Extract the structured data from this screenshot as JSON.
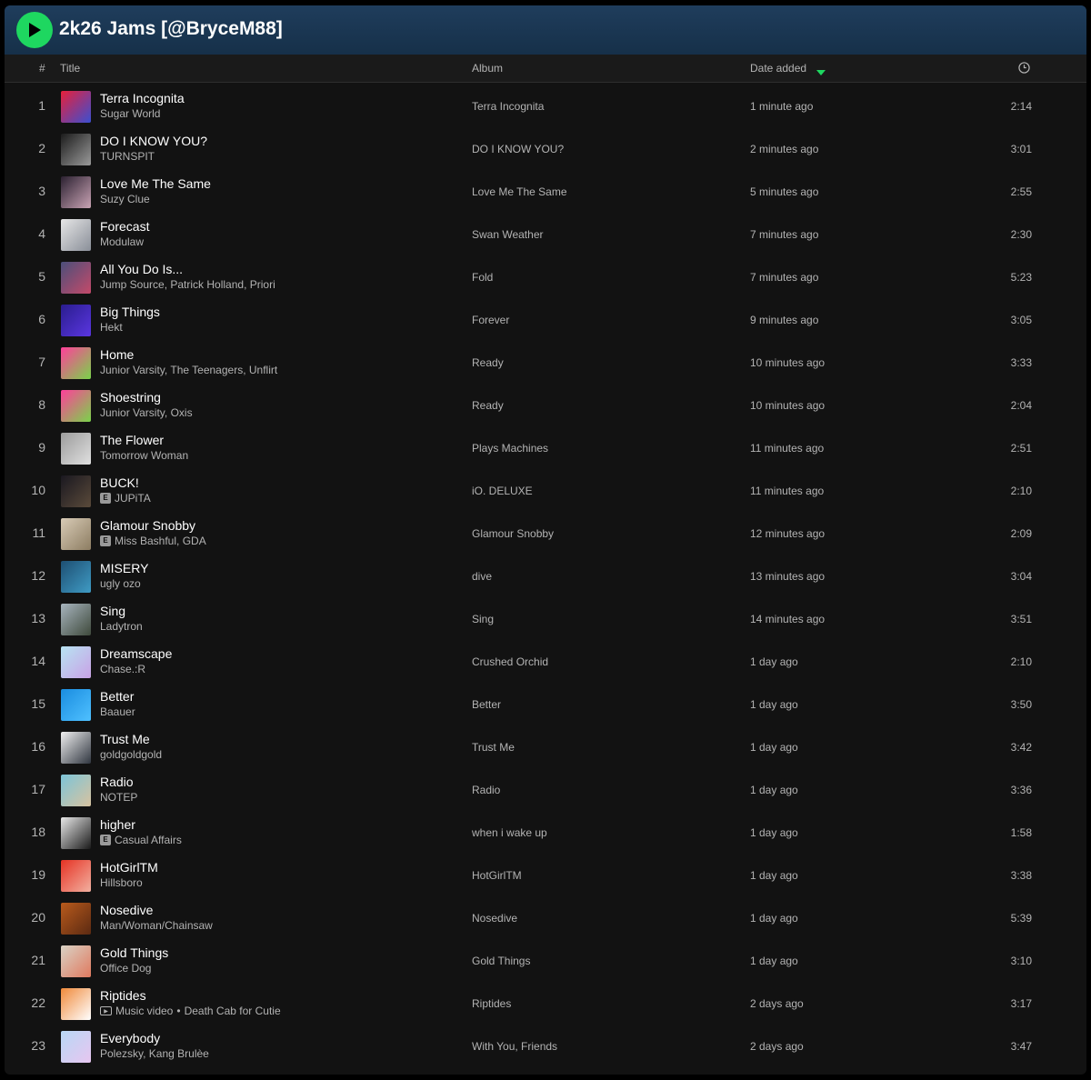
{
  "playlist": {
    "title": "2k26 Jams [@BryceM88]"
  },
  "colors": {
    "accent": "#1ed760",
    "header_bg": "#1f3d5c",
    "background": "#121212"
  },
  "columns": {
    "num": "#",
    "title": "Title",
    "album": "Album",
    "date_added": "Date added",
    "duration_icon": "clock-icon",
    "sort_indicator": "sort-desc-icon"
  },
  "tracks": [
    {
      "n": "1",
      "title": "Terra Incognita",
      "artist": "Sugar World",
      "album": "Terra Incognita",
      "added": "1 minute ago",
      "duration": "2:14",
      "explicit": false,
      "music_video": false,
      "art": [
        "#e8203a",
        "#3b4fd1"
      ]
    },
    {
      "n": "2",
      "title": "DO I KNOW YOU?",
      "artist": "TURNSPIT",
      "album": "DO I KNOW YOU?",
      "added": "2 minutes ago",
      "duration": "3:01",
      "explicit": false,
      "music_video": false,
      "art": [
        "#1c1c1c",
        "#9a9a9a"
      ]
    },
    {
      "n": "3",
      "title": "Love Me The Same",
      "artist": "Suzy Clue",
      "album": "Love Me The Same",
      "added": "5 minutes ago",
      "duration": "2:55",
      "explicit": false,
      "music_video": false,
      "art": [
        "#2b2131",
        "#c9a3b4"
      ]
    },
    {
      "n": "4",
      "title": "Forecast",
      "artist": "Modulaw",
      "album": "Swan Weather",
      "added": "7 minutes ago",
      "duration": "2:30",
      "explicit": false,
      "music_video": false,
      "art": [
        "#e6e6e6",
        "#8a8f99"
      ]
    },
    {
      "n": "5",
      "title": "All You Do Is...",
      "artist": "Jump Source, Patrick Holland, Priori",
      "album": "Fold",
      "added": "7 minutes ago",
      "duration": "5:23",
      "explicit": false,
      "music_video": false,
      "art": [
        "#4b4f7a",
        "#c44a6a"
      ]
    },
    {
      "n": "6",
      "title": "Big Things",
      "artist": "Hekt",
      "album": "Forever",
      "added": "9 minutes ago",
      "duration": "3:05",
      "explicit": false,
      "music_video": false,
      "art": [
        "#2a1d8f",
        "#5a36e0"
      ]
    },
    {
      "n": "7",
      "title": "Home",
      "artist": "Junior Varsity, The Teenagers, Unflirt",
      "album": "Ready",
      "added": "10 minutes ago",
      "duration": "3:33",
      "explicit": false,
      "music_video": false,
      "art": [
        "#ff3f9a",
        "#7ad34a"
      ]
    },
    {
      "n": "8",
      "title": "Shoestring",
      "artist": "Junior Varsity, Oxis",
      "album": "Ready",
      "added": "10 minutes ago",
      "duration": "2:04",
      "explicit": false,
      "music_video": false,
      "art": [
        "#ff3f9a",
        "#7ad34a"
      ]
    },
    {
      "n": "9",
      "title": "The Flower",
      "artist": "Tomorrow Woman",
      "album": "Plays Machines",
      "added": "11 minutes ago",
      "duration": "2:51",
      "explicit": false,
      "music_video": false,
      "art": [
        "#9c9c9c",
        "#e0e0e0"
      ]
    },
    {
      "n": "10",
      "title": "BUCK!",
      "artist": "JUPiTA",
      "album": "iO. DELUXE",
      "added": "11 minutes ago",
      "duration": "2:10",
      "explicit": true,
      "music_video": false,
      "art": [
        "#1a1820",
        "#5a4a3a"
      ]
    },
    {
      "n": "11",
      "title": "Glamour Snobby",
      "artist": "Miss Bashful, GDA",
      "album": "Glamour Snobby",
      "added": "12 minutes ago",
      "duration": "2:09",
      "explicit": true,
      "music_video": false,
      "art": [
        "#d8cbb6",
        "#8d7d62"
      ]
    },
    {
      "n": "12",
      "title": "MISERY",
      "artist": "ugly ozo",
      "album": "dive",
      "added": "13 minutes ago",
      "duration": "3:04",
      "explicit": false,
      "music_video": false,
      "art": [
        "#1e4f73",
        "#3f9bc4"
      ]
    },
    {
      "n": "13",
      "title": "Sing",
      "artist": "Ladytron",
      "album": "Sing",
      "added": "14 minutes ago",
      "duration": "3:51",
      "explicit": false,
      "music_video": false,
      "art": [
        "#a7b4be",
        "#3f4a3c"
      ]
    },
    {
      "n": "14",
      "title": "Dreamscape",
      "artist": "Chase.:R",
      "album": "Crushed Orchid",
      "added": "1 day ago",
      "duration": "2:10",
      "explicit": false,
      "music_video": false,
      "art": [
        "#b7e3f2",
        "#c9a2e6"
      ]
    },
    {
      "n": "15",
      "title": "Better",
      "artist": "Baauer",
      "album": "Better",
      "added": "1 day ago",
      "duration": "3:50",
      "explicit": false,
      "music_video": false,
      "art": [
        "#1a8de0",
        "#4fc0ff"
      ]
    },
    {
      "n": "16",
      "title": "Trust Me",
      "artist": "goldgoldgold",
      "album": "Trust Me",
      "added": "1 day ago",
      "duration": "3:42",
      "explicit": false,
      "music_video": false,
      "art": [
        "#f0f0f0",
        "#303640"
      ]
    },
    {
      "n": "17",
      "title": "Radio",
      "artist": "NOTEP",
      "album": "Radio",
      "added": "1 day ago",
      "duration": "3:36",
      "explicit": false,
      "music_video": false,
      "art": [
        "#7cc4d8",
        "#d8c3a0"
      ]
    },
    {
      "n": "18",
      "title": "higher",
      "artist": "Casual Affairs",
      "album": "when i wake up",
      "added": "1 day ago",
      "duration": "1:58",
      "explicit": true,
      "music_video": false,
      "art": [
        "#e8e8e8",
        "#1a1a1a"
      ]
    },
    {
      "n": "19",
      "title": "HotGirlTM",
      "artist": "Hillsboro",
      "album": "HotGirlTM",
      "added": "1 day ago",
      "duration": "3:38",
      "explicit": false,
      "music_video": false,
      "art": [
        "#e63324",
        "#f2b0a0"
      ]
    },
    {
      "n": "20",
      "title": "Nosedive",
      "artist": "Man/Woman/Chainsaw",
      "album": "Nosedive",
      "added": "1 day ago",
      "duration": "5:39",
      "explicit": false,
      "music_video": false,
      "art": [
        "#b85a1c",
        "#5c2a12"
      ]
    },
    {
      "n": "21",
      "title": "Gold Things",
      "artist": "Office Dog",
      "album": "Gold Things",
      "added": "1 day ago",
      "duration": "3:10",
      "explicit": false,
      "music_video": false,
      "art": [
        "#d9d2c5",
        "#e07a5f"
      ]
    },
    {
      "n": "22",
      "title": "Riptides",
      "artist": "Death Cab for Cutie",
      "music_video_label": "Music video",
      "album": "Riptides",
      "added": "2 days ago",
      "duration": "3:17",
      "explicit": false,
      "music_video": true,
      "art": [
        "#f08a3a",
        "#ffffff"
      ]
    },
    {
      "n": "23",
      "title": "Everybody",
      "artist": "Polezsky, Kang Brulèe",
      "album": "With You, Friends",
      "added": "2 days ago",
      "duration": "3:47",
      "explicit": false,
      "music_video": false,
      "art": [
        "#b8d8f5",
        "#e7c6f0"
      ]
    }
  ]
}
